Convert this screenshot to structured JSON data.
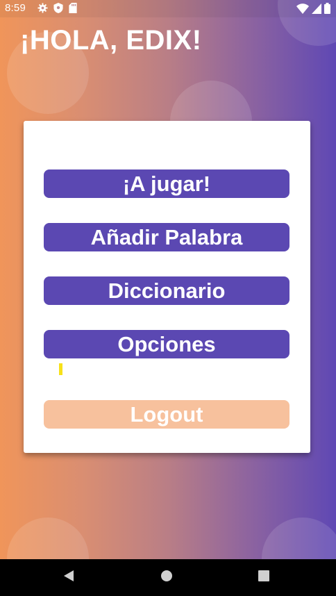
{
  "status_bar": {
    "time": "8:59",
    "icons_left": [
      "settings-icon",
      "shield-icon",
      "sd-card-icon"
    ],
    "icons_right": [
      "wifi-icon",
      "signal-icon",
      "battery-icon"
    ]
  },
  "header": {
    "greeting": "¡HOLA, EDIX!"
  },
  "menu": {
    "play_label": "¡A jugar!",
    "add_word_label": "Añadir Palabra",
    "dictionary_label": "Diccionario",
    "options_label": "Opciones",
    "logout_label": "Logout"
  },
  "nav_bar": {
    "icons": [
      "back-icon",
      "home-icon",
      "recents-icon"
    ]
  },
  "colors": {
    "gradient_start": "#f0955a",
    "gradient_end": "#5f48b4",
    "primary_button": "#5b48b2",
    "logout_button": "#f7c19d",
    "card_background": "#ffffff",
    "text_light": "#ffffff"
  }
}
